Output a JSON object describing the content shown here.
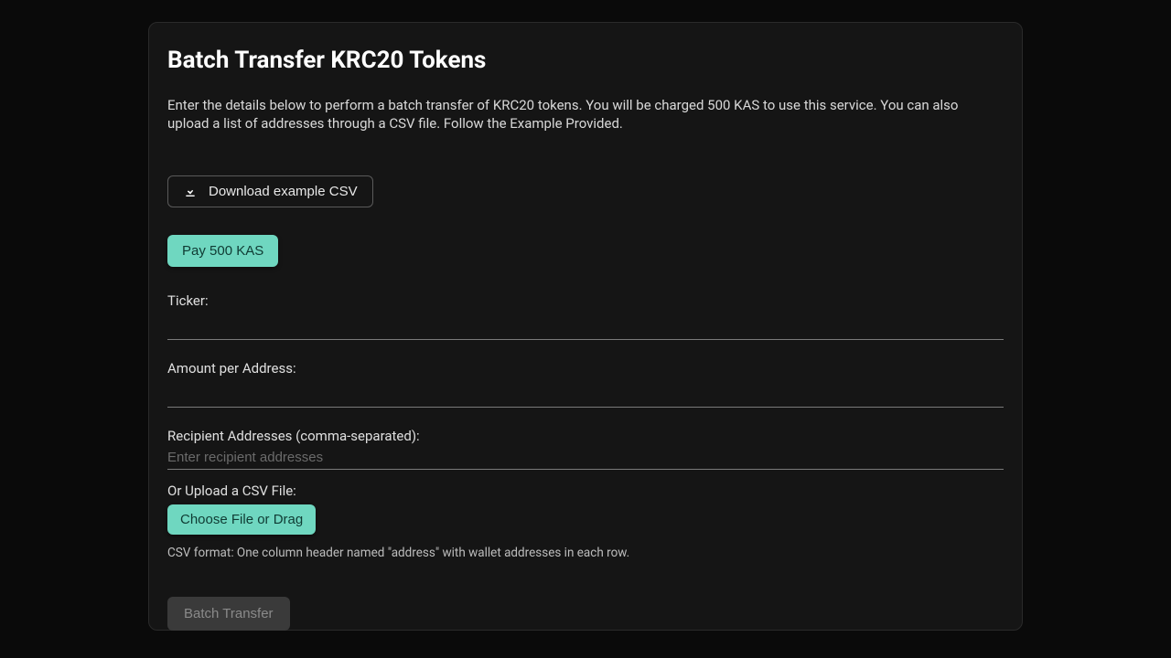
{
  "title": "Batch Transfer KRC20 Tokens",
  "description": "Enter the details below to perform a batch transfer of KRC20 tokens. You will be charged 500 KAS to use this service. You can also upload a list of addresses through a CSV file. Follow the Example Provided.",
  "buttons": {
    "download_csv": "Download example CSV",
    "pay": "Pay 500 KAS",
    "choose_file": "Choose File or Drag",
    "submit": "Batch Transfer"
  },
  "fields": {
    "ticker_label": "Ticker:",
    "ticker_value": "",
    "amount_label": "Amount per Address:",
    "amount_value": "",
    "recipients_label": "Recipient Addresses (comma-separated):",
    "recipients_placeholder": "Enter recipient addresses",
    "recipients_value": "",
    "upload_label": "Or Upload a CSV File:",
    "csv_hint": "CSV format: One column header named \"address\" with wallet addresses in each row."
  },
  "colors": {
    "accent": "#6fd7c0",
    "bg": "#0a0a0a",
    "card": "#151515"
  }
}
